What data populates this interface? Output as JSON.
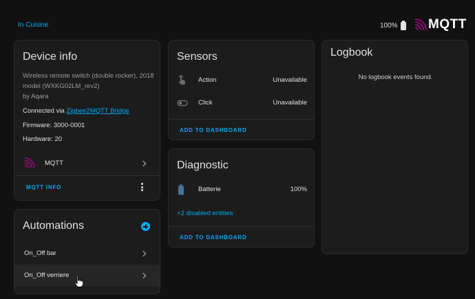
{
  "header": {
    "breadcrumb": "In Cuisine",
    "battery_percent": "100%",
    "brand_text": "MQTT",
    "brand_color": "#8b0d76"
  },
  "device_info": {
    "title": "Device info",
    "description": "Wireless remote switch (double rocker), 2018 model (WXKG02LM_rev2)",
    "manufacturer": "by Aqara",
    "connected_prefix": "Connected via ",
    "connected_link": "Zigbee2MQTT Bridge",
    "firmware": "Firmware: 3000-0001",
    "hardware": "Hardware: 20",
    "integration_label": "MQTT",
    "action_label": "MQTT INFO"
  },
  "automations": {
    "title": "Automations",
    "items": [
      {
        "label": "On_Off bar"
      },
      {
        "label": "On_Off verriere"
      }
    ]
  },
  "sensors": {
    "title": "Sensors",
    "entities": [
      {
        "name": "Action",
        "state": "Unavailable",
        "icon": "gesture-tap-icon"
      },
      {
        "name": "Click",
        "state": "Unavailable",
        "icon": "toggle-switch-icon"
      }
    ],
    "action_label": "ADD TO DASHBOARD"
  },
  "diagnostic": {
    "title": "Diagnostic",
    "entities": [
      {
        "name": "Batterie",
        "state": "100%",
        "icon": "battery-icon"
      }
    ],
    "disabled_link": "+2 disabled entities",
    "action_label": "ADD TO DASHBOARD"
  },
  "logbook": {
    "title": "Logbook",
    "empty_message": "No logbook events found."
  },
  "colors": {
    "accent": "#03a9f4",
    "card_bg": "#1c1c1c",
    "page_bg": "#111111",
    "entity_icon": "#44739e"
  }
}
